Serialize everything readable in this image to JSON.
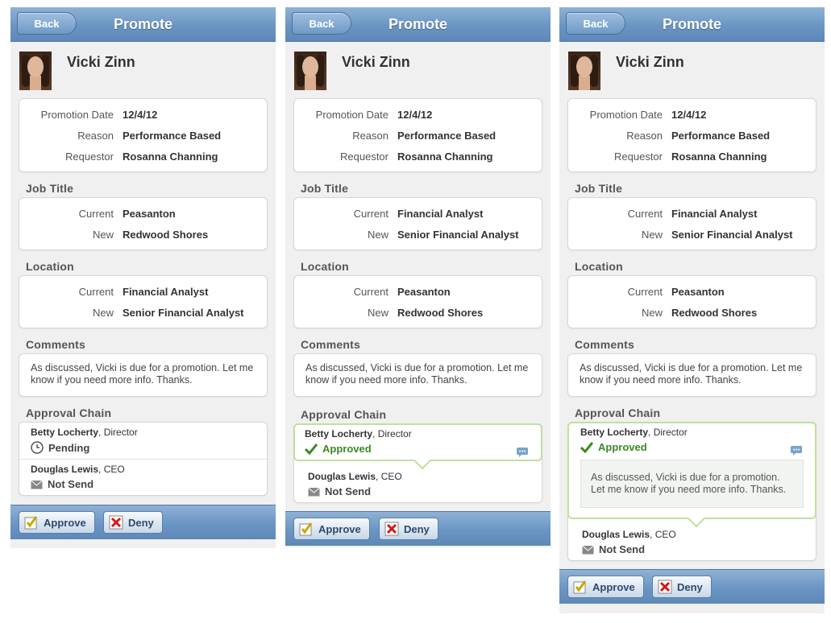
{
  "header": {
    "back_label": "Back",
    "title": "Promote"
  },
  "employee": {
    "name": "Vicki Zinn"
  },
  "summary": [
    {
      "label": "Promotion Date",
      "value": "12/4/12"
    },
    {
      "label": "Reason",
      "value": "Performance Based"
    },
    {
      "label": "Requestor",
      "value": "Rosanna Channing"
    }
  ],
  "sections": {
    "job_title": "Job Title",
    "location": "Location",
    "comments": "Comments",
    "approval_chain": "Approval Chain"
  },
  "labels": {
    "current": "Current",
    "new": "New"
  },
  "screens": [
    {
      "job_title": {
        "current": "Peasanton",
        "new": "Redwood Shores"
      },
      "location": {
        "current": "Financial Analyst",
        "new": "Senior Financial Analyst"
      }
    },
    {
      "job_title": {
        "current": "Financial Analyst",
        "new": "Senior Financial Analyst"
      },
      "location": {
        "current": "Peasanton",
        "new": "Redwood Shores"
      }
    },
    {
      "job_title": {
        "current": "Financial Analyst",
        "new": "Senior Financial Analyst"
      },
      "location": {
        "current": "Peasanton",
        "new": "Redwood Shores"
      }
    }
  ],
  "comment_text": "As discussed, Vicki is due for a promotion. Let me know if you need more info. Thanks.",
  "approvers": [
    {
      "name": "Betty Locherty",
      "role": ", Director"
    },
    {
      "name": "Douglas Lewis",
      "role": ", CEO"
    }
  ],
  "status": {
    "pending": "Pending",
    "approved": "Approved",
    "not_send": "Not Send"
  },
  "footer": {
    "approve_label": "Approve",
    "deny_label": "Deny"
  },
  "colors": {
    "header_blue": "#6a95c3",
    "approved_green": "#3a8a25",
    "highlight_border": "#bfe0a0"
  }
}
